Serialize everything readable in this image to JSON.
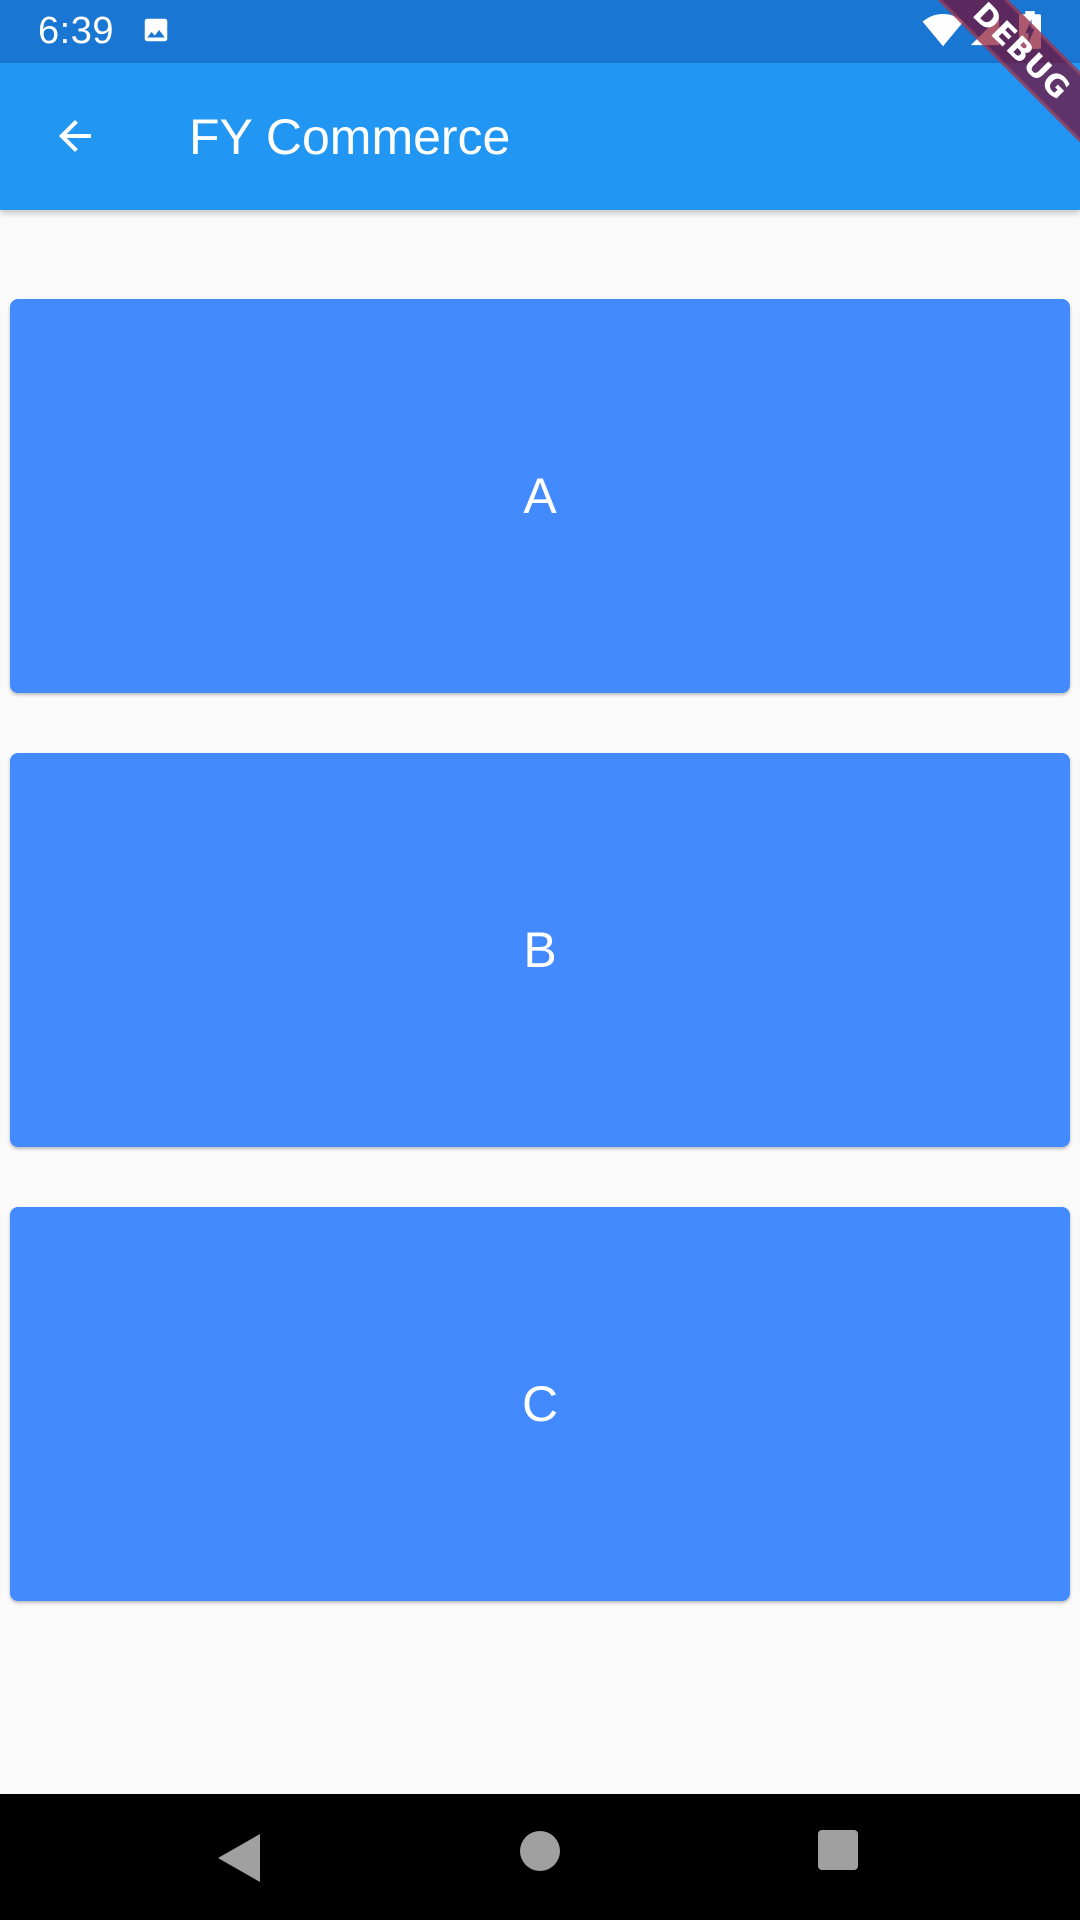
{
  "status_bar": {
    "time": "6:39",
    "icons": [
      "image-icon",
      "wifi-icon",
      "signal-icon",
      "battery-charging-icon"
    ],
    "color": "#1976d2"
  },
  "app_bar": {
    "title": "FY Commerce",
    "back_icon": "arrow-back-icon",
    "color": "#2196f3"
  },
  "debug_banner": {
    "label": "DEBUG"
  },
  "buttons": [
    {
      "label": "A"
    },
    {
      "label": "B"
    },
    {
      "label": "C"
    }
  ],
  "button_color": "#448aff",
  "nav_bar": {
    "icons": [
      "nav-back-icon",
      "nav-home-icon",
      "nav-recents-icon"
    ]
  }
}
